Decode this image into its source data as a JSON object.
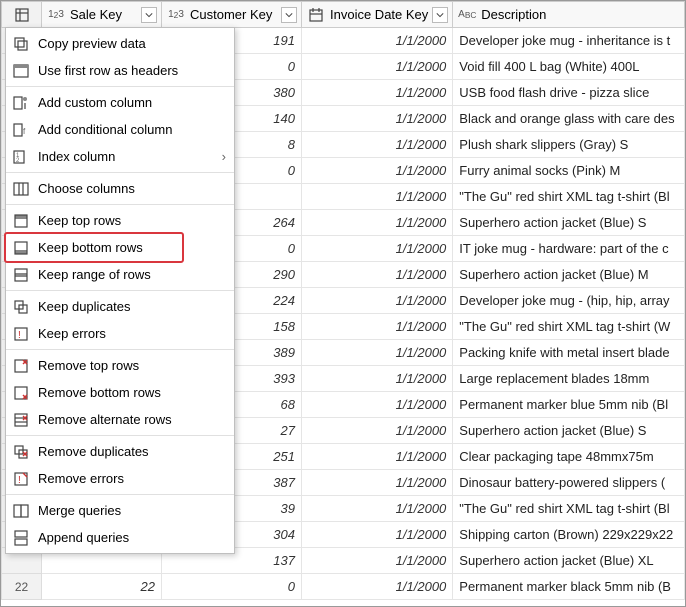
{
  "columns": {
    "sale": {
      "label": "Sale Key",
      "type": "number"
    },
    "customer": {
      "label": "Customer Key",
      "type": "number"
    },
    "invoice": {
      "label": "Invoice Date Key",
      "type": "date"
    },
    "description": {
      "label": "Description",
      "type": "text"
    }
  },
  "menu": {
    "copy_preview": "Copy preview data",
    "use_first_row": "Use first row as headers",
    "add_custom": "Add custom column",
    "add_conditional": "Add conditional column",
    "index_column": "Index column",
    "choose_columns": "Choose columns",
    "keep_top": "Keep top rows",
    "keep_bottom": "Keep bottom rows",
    "keep_range": "Keep range of rows",
    "keep_duplicates": "Keep duplicates",
    "keep_errors": "Keep errors",
    "remove_top": "Remove top rows",
    "remove_bottom": "Remove bottom rows",
    "remove_alternate": "Remove alternate rows",
    "remove_duplicates": "Remove duplicates",
    "remove_errors": "Remove errors",
    "merge_queries": "Merge queries",
    "append_queries": "Append queries"
  },
  "rows": [
    {
      "n": "",
      "sale": "",
      "cust": 191,
      "date": "1/1/2000",
      "desc": "Developer joke mug - inheritance is t"
    },
    {
      "n": "",
      "sale": "",
      "cust": 0,
      "date": "1/1/2000",
      "desc": "Void fill 400 L bag (White) 400L"
    },
    {
      "n": "",
      "sale": "",
      "cust": 380,
      "date": "1/1/2000",
      "desc": "USB food flash drive - pizza slice"
    },
    {
      "n": "",
      "sale": "",
      "cust": 140,
      "date": "1/1/2000",
      "desc": "Black and orange glass with care des"
    },
    {
      "n": "",
      "sale": "",
      "cust": 8,
      "date": "1/1/2000",
      "desc": "Plush shark slippers (Gray) S"
    },
    {
      "n": "",
      "sale": "",
      "cust": 0,
      "date": "1/1/2000",
      "desc": "Furry animal socks (Pink) M"
    },
    {
      "n": "",
      "sale": "",
      "cust": "",
      "date": "1/1/2000",
      "desc": "\"The Gu\" red shirt XML tag t-shirt (Bl"
    },
    {
      "n": "",
      "sale": "",
      "cust": 264,
      "date": "1/1/2000",
      "desc": "Superhero action jacket (Blue) S"
    },
    {
      "n": "",
      "sale": "",
      "cust": 0,
      "date": "1/1/2000",
      "desc": "IT joke mug - hardware: part of the c"
    },
    {
      "n": "",
      "sale": "",
      "cust": 290,
      "date": "1/1/2000",
      "desc": "Superhero action jacket (Blue) M"
    },
    {
      "n": "",
      "sale": "",
      "cust": 224,
      "date": "1/1/2000",
      "desc": "Developer joke mug - (hip, hip, array"
    },
    {
      "n": "",
      "sale": "",
      "cust": 158,
      "date": "1/1/2000",
      "desc": "\"The Gu\" red shirt XML tag t-shirt (W"
    },
    {
      "n": "",
      "sale": "",
      "cust": 389,
      "date": "1/1/2000",
      "desc": "Packing knife with metal insert blade"
    },
    {
      "n": "",
      "sale": "",
      "cust": 393,
      "date": "1/1/2000",
      "desc": "Large replacement blades 18mm"
    },
    {
      "n": "",
      "sale": "",
      "cust": 68,
      "date": "1/1/2000",
      "desc": "Permanent marker blue 5mm nib (Bl"
    },
    {
      "n": "",
      "sale": "",
      "cust": 27,
      "date": "1/1/2000",
      "desc": "Superhero action jacket (Blue) S"
    },
    {
      "n": "",
      "sale": "",
      "cust": 251,
      "date": "1/1/2000",
      "desc": "Clear packaging tape 48mmx75m"
    },
    {
      "n": "",
      "sale": "",
      "cust": 387,
      "date": "1/1/2000",
      "desc": "Dinosaur battery-powered slippers ("
    },
    {
      "n": "",
      "sale": "",
      "cust": 39,
      "date": "1/1/2000",
      "desc": "\"The Gu\" red shirt XML tag t-shirt (Bl"
    },
    {
      "n": "",
      "sale": "",
      "cust": 304,
      "date": "1/1/2000",
      "desc": "Shipping carton (Brown) 229x229x22"
    },
    {
      "n": "",
      "sale": "",
      "cust": 137,
      "date": "1/1/2000",
      "desc": "Superhero action jacket (Blue) XL"
    },
    {
      "n": 22,
      "sale": 22,
      "cust": 0,
      "date": "1/1/2000",
      "desc": "Permanent marker black 5mm nib (B"
    }
  ],
  "highlight": {
    "target": "keep_bottom"
  }
}
